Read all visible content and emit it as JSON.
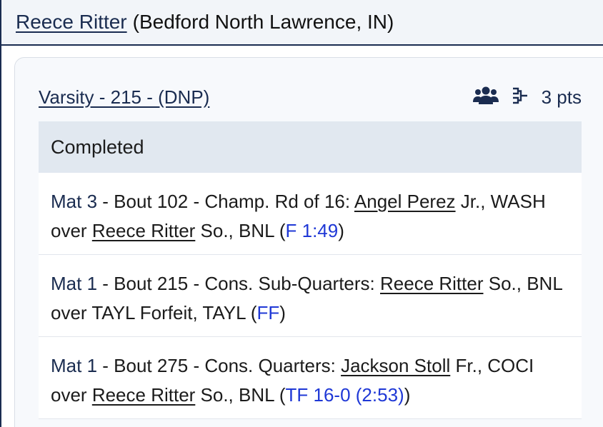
{
  "header": {
    "wrestler_name": "Reece Ritter",
    "school": "(Bedford North Lawrence, IN)"
  },
  "division": {
    "label": "Varsity - 215 - (DNP)",
    "team_icon": "people-group-icon",
    "bracket_icon": "bracket-icon",
    "points": "3 pts"
  },
  "section": {
    "title": "Completed"
  },
  "matches": [
    {
      "mat": "Mat 3",
      "bout": " - Bout 102 - Champ. Rd of 16: ",
      "winner": "Angel Perez",
      "winner_suffix": " Jr., WASH over ",
      "loser": "Reece Ritter",
      "loser_suffix": " So., BNL (",
      "result": "F 1:49",
      "close": ")"
    },
    {
      "mat": "Mat 1",
      "bout": " - Bout 215 - Cons. Sub-Quarters: ",
      "winner": "Reece Ritter",
      "winner_suffix": " So., BNL over TAYL Forfeit, TAYL (",
      "loser": "",
      "loser_suffix": "",
      "result": "FF",
      "close": ")"
    },
    {
      "mat": "Mat 1",
      "bout": " - Bout 275 - Cons. Quarters: ",
      "winner": "Jackson Stoll",
      "winner_suffix": " Fr., COCI over ",
      "loser": "Reece Ritter",
      "loser_suffix": " So., BNL (",
      "result": "TF 16-0 (2:53)",
      "close": ")"
    }
  ],
  "colors": {
    "navy": "#1a2c50",
    "result_link": "#1f38d6",
    "section_bg": "#e1e8f0"
  }
}
